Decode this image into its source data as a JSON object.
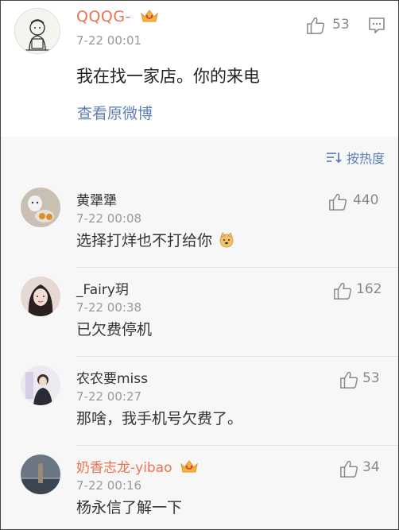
{
  "post": {
    "username": "QQQG-",
    "time": "7-22 00:01",
    "likes": "53",
    "text": "我在找一家店。你的来电",
    "view_original": "查看原微博",
    "colors": {
      "username": "#eb7350",
      "link": "#5d7fb6"
    }
  },
  "sort": {
    "label": "按热度",
    "icon": "sort-lines-icon"
  },
  "comments": [
    {
      "username": "黄犟犟",
      "time": "7-22 00:08",
      "text": "选择打烊也不打给你",
      "likes": "440",
      "emoji": "doge-emoji-icon",
      "vip": false
    },
    {
      "username": "_Fairy玥",
      "time": "7-22 00:38",
      "text": "已欠费停机",
      "likes": "162",
      "vip": false
    },
    {
      "username": "农农要miss",
      "time": "7-22 00:27",
      "text": "那啥，我手机号欠费了。",
      "likes": "53",
      "vip": false
    },
    {
      "username": "奶香志龙-yibao",
      "time": "7-22 00:16",
      "text": "杨永信了解一下",
      "likes": "34",
      "vip": true
    }
  ]
}
